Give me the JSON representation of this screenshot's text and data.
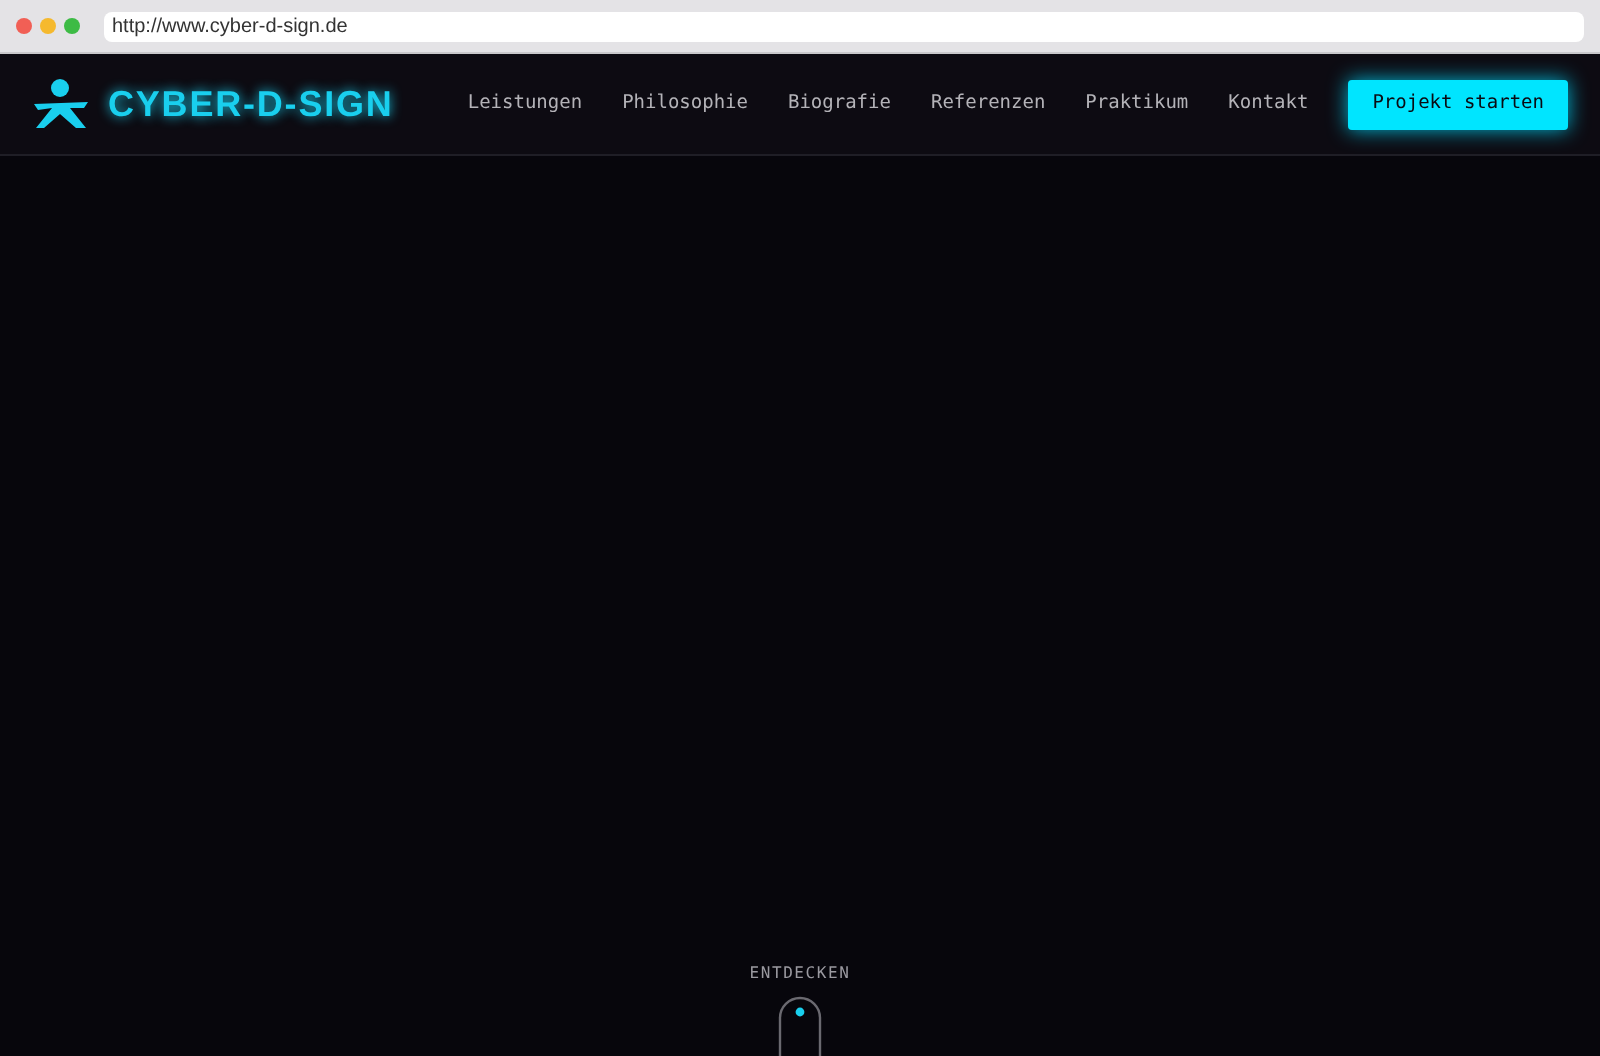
{
  "browser": {
    "url": "http://www.cyber-d-sign.de"
  },
  "header": {
    "logo": "CYBER-D-SIGN",
    "nav": [
      {
        "label": "Leistungen"
      },
      {
        "label": "Philosophie"
      },
      {
        "label": "Biografie"
      },
      {
        "label": "Referenzen"
      },
      {
        "label": "Praktikum"
      },
      {
        "label": "Kontakt"
      }
    ],
    "cta": "Projekt starten"
  },
  "hero": {
    "scroll_hint": "ENTDECKEN"
  }
}
